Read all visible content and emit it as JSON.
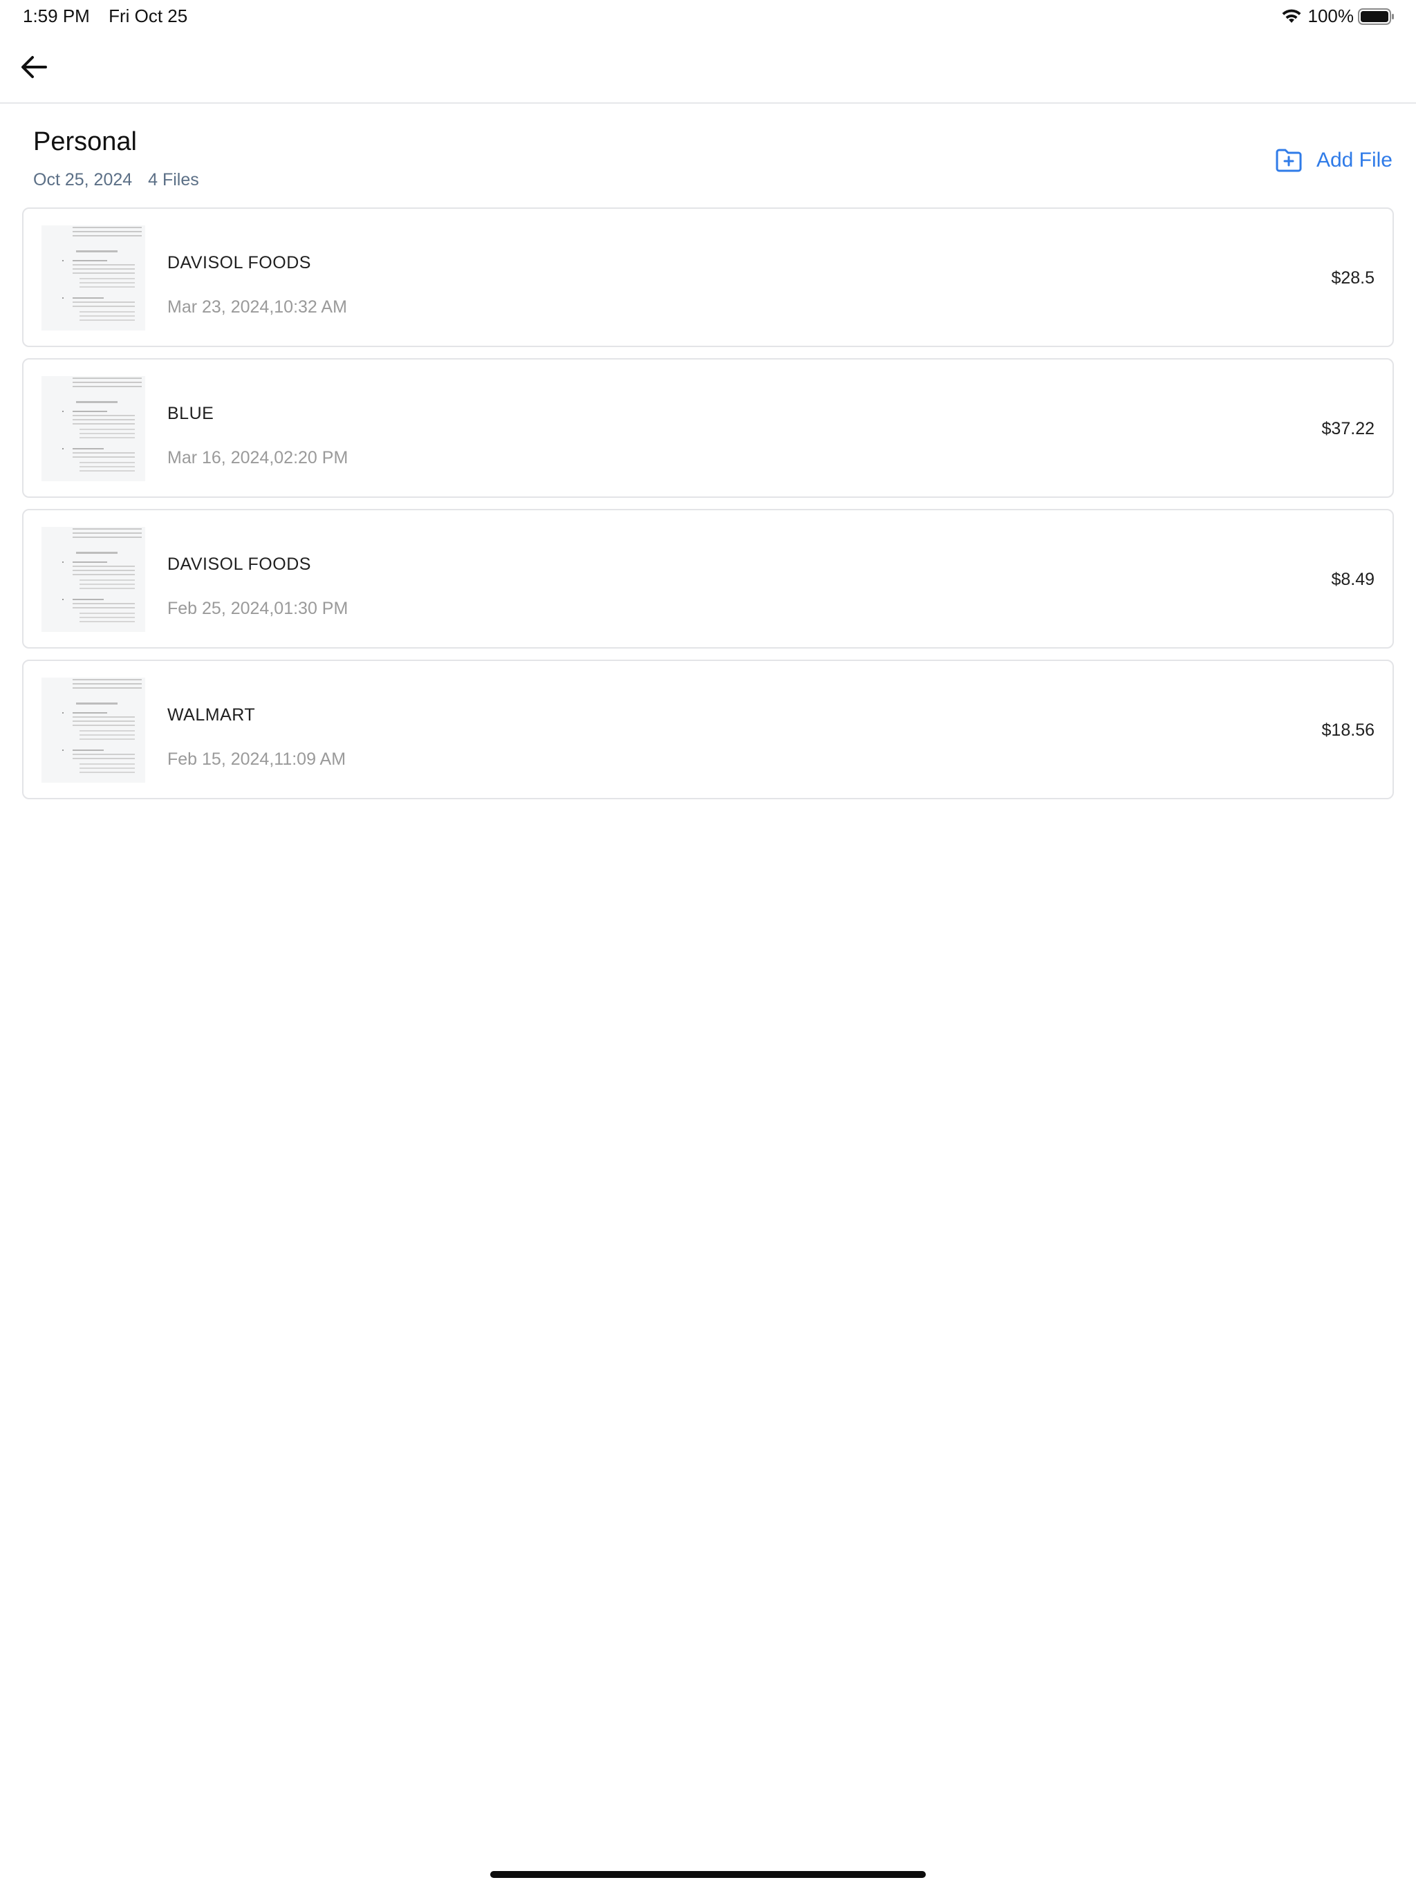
{
  "status_bar": {
    "time": "1:59 PM",
    "date": "Fri Oct 25",
    "battery_percent": "100%"
  },
  "nav": {
    "back_icon": "arrow-left-icon"
  },
  "folder": {
    "title": "Personal",
    "date": "Oct 25, 2024",
    "file_count": "4 Files",
    "add_file_label": "Add File",
    "accent_color": "#2f7be8"
  },
  "files": [
    {
      "name": "DAVISOL FOODS",
      "date": "Mar 23, 2024,10:32 AM",
      "amount": "$28.5"
    },
    {
      "name": "BLUE",
      "date": "Mar 16, 2024,02:20 PM",
      "amount": "$37.22"
    },
    {
      "name": "DAVISOL FOODS",
      "date": "Feb 25, 2024,01:30 PM",
      "amount": "$8.49"
    },
    {
      "name": "WALMART",
      "date": "Feb 15, 2024,11:09 AM",
      "amount": "$18.56"
    }
  ]
}
